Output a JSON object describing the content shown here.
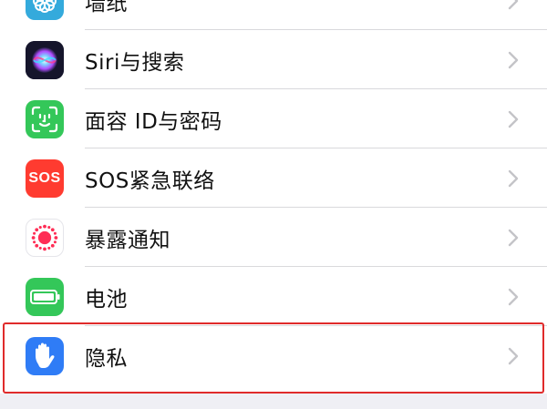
{
  "settings": {
    "items": [
      {
        "label": "墙纸",
        "icon": "wallpaper-icon",
        "color": "#34aadc"
      },
      {
        "label": "Siri与搜索",
        "icon": "siri-icon",
        "color": "#1c1c3a"
      },
      {
        "label": "面容 ID与密码",
        "icon": "face-id-icon",
        "color": "#34c759"
      },
      {
        "label": "SOS紧急联络",
        "icon": "sos-icon",
        "color": "#ff3b30",
        "badge": "SOS"
      },
      {
        "label": "暴露通知",
        "icon": "exposure-notification-icon",
        "color": "#ff2d55"
      },
      {
        "label": "电池",
        "icon": "battery-icon",
        "color": "#34c759"
      },
      {
        "label": "隐私",
        "icon": "privacy-hand-icon",
        "color": "#2f7cf6"
      }
    ]
  },
  "highlight_color": "#e02b2b"
}
